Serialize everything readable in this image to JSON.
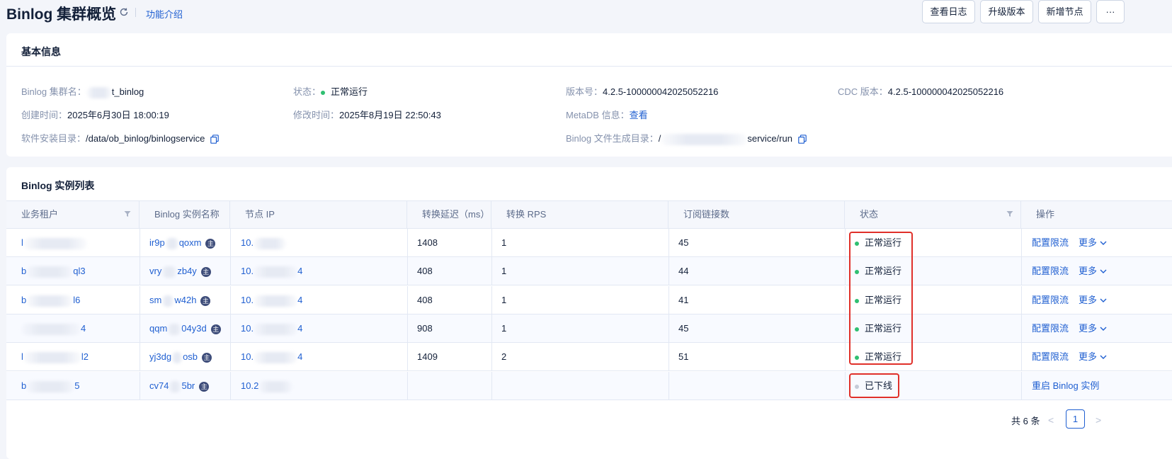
{
  "header": {
    "title": "Binlog 集群概览",
    "intro_link": "功能介绍",
    "buttons": [
      "查看日志",
      "升级版本",
      "新增节点",
      "···"
    ]
  },
  "basic_info": {
    "title": "基本信息",
    "cluster_name_label": "Binlog 集群名：",
    "cluster_name_value": "t_binlog",
    "status_label": "状态：",
    "status_value": "正常运行",
    "version_label": "版本号：",
    "version_value": "4.2.5-100000042025052216",
    "cdc_version_label": "CDC 版本：",
    "cdc_version_value": "4.2.5-100000042025052216",
    "created_label": "创建时间：",
    "created_value": "2025年6月30日 18:00:19",
    "modified_label": "修改时间：",
    "modified_value": "2025年8月19日 22:50:43",
    "metadb_label": "MetaDB 信息：",
    "metadb_link": "查看",
    "install_dir_label": "软件安装目录：",
    "install_dir_value": "/data/ob_binlog/binlogservice",
    "binlog_dir_label": "Binlog 文件生成目录：",
    "binlog_dir_prefix": "/",
    "binlog_dir_suffix": "service/run"
  },
  "instances": {
    "title": "Binlog 实例列表",
    "columns": [
      "业务租户",
      "Binlog 实例名称",
      "节点 IP",
      "转换延迟（ms）",
      "转换 RPS",
      "订阅链接数",
      "状态",
      "操作"
    ],
    "master_badge": "主",
    "rows": [
      {
        "tenant": "l",
        "name_a": "ir9p",
        "name_b": "qoxm",
        "ip_a": "10.",
        "ip_b": "",
        "delay": "1408",
        "rps": "1",
        "links": "45",
        "status": "正常运行",
        "status_color": "#2fbf71",
        "action": "配置限流",
        "more": "更多"
      },
      {
        "tenant": "b",
        "tenant_b": "ql3",
        "name_a": "vry",
        "name_b": "zb4y",
        "ip_a": "10.",
        "ip_b": "4",
        "delay": "408",
        "rps": "1",
        "links": "44",
        "status": "正常运行",
        "status_color": "#2fbf71",
        "action": "配置限流",
        "more": "更多"
      },
      {
        "tenant": "b",
        "tenant_b": "l6",
        "name_a": "sm",
        "name_b": "w42h",
        "ip_a": "10.",
        "ip_b": "4",
        "delay": "408",
        "rps": "1",
        "links": "41",
        "status": "正常运行",
        "status_color": "#2fbf71",
        "action": "配置限流",
        "more": "更多"
      },
      {
        "tenant": "",
        "tenant_b": "4",
        "name_a": "qqm",
        "name_b": "04y3d",
        "ip_a": "10.",
        "ip_b": "4",
        "delay": "908",
        "rps": "1",
        "links": "45",
        "status": "正常运行",
        "status_color": "#2fbf71",
        "action": "配置限流",
        "more": "更多"
      },
      {
        "tenant": "l",
        "tenant_b": "l2",
        "name_a": "yj3dg",
        "name_b": "osb",
        "ip_a": "10.",
        "ip_b": "4",
        "delay": "1409",
        "rps": "2",
        "links": "51",
        "status": "正常运行",
        "status_color": "#2fbf71",
        "action": "配置限流",
        "more": "更多"
      },
      {
        "tenant": "b",
        "tenant_b": "5",
        "name_a": "cv74",
        "name_b": "5br",
        "ip_a": "10.2",
        "ip_b": "",
        "delay": "",
        "rps": "",
        "links": "",
        "status": "已下线",
        "status_color": "#c5cbd8",
        "action": "重启 Binlog 实例",
        "more": ""
      }
    ]
  },
  "pagination": {
    "total": "共 6 条",
    "prev": "<",
    "page": "1",
    "next": ">"
  }
}
